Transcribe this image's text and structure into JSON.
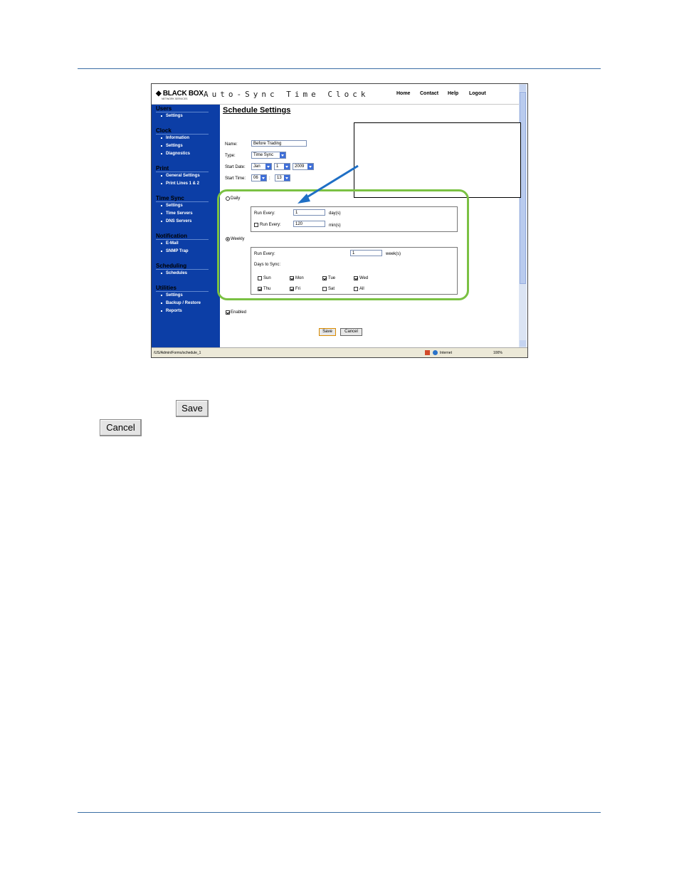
{
  "app": {
    "logo": "BLACK BOX",
    "logo_sub": "NETWORK SERVICES",
    "title": "Auto-Sync Time Clock",
    "nav": {
      "home": "Home",
      "contact": "Contact",
      "help": "Help",
      "logout": "Logout"
    }
  },
  "sidebar": {
    "users": {
      "title": "Users",
      "items": [
        "Settings"
      ]
    },
    "clock": {
      "title": "Clock",
      "items": [
        "Information",
        "Settings",
        "Diagnostics"
      ]
    },
    "print": {
      "title": "Print",
      "items": [
        "General Settings",
        "Print Lines 1 & 2"
      ]
    },
    "timesync": {
      "title": "Time Sync",
      "items": [
        "Settings",
        "Time Servers",
        "DNS Servers"
      ]
    },
    "notification": {
      "title": "Notification",
      "items": [
        "E-Mail",
        "SNMP Trap"
      ]
    },
    "scheduling": {
      "title": "Scheduling",
      "items": [
        "Schedules"
      ]
    },
    "utilities": {
      "title": "Utilities",
      "items": [
        "Settings",
        "Backup / Restore",
        "Reports"
      ]
    }
  },
  "form": {
    "page_title": "Schedule Settings",
    "name_label": "Name:",
    "name_value": "Before Trading",
    "type_label": "Type:",
    "type_value": "Time Sync",
    "start_date_label": "Start Date:",
    "month": "Jan",
    "day": "1",
    "year": "2009",
    "start_time_label": "Start Time:",
    "hour": "06",
    "time_sep": ":",
    "minute": "13",
    "daily_label": "Daily",
    "daily_selected": false,
    "run_every_label": "Run Every:",
    "daily_run_every": "1",
    "days_unit": "day(s)",
    "minutes_checked": false,
    "minutes_run_every": "120",
    "minutes_unit": "min(s)",
    "weekly_label": "Weekly",
    "weekly_selected": true,
    "weekly_run_every": "1",
    "weeks_unit": "week(s)",
    "days_to_sync_label": "Days to Sync:",
    "days": {
      "sun": {
        "label": "Sun",
        "checked": false
      },
      "mon": {
        "label": "Mon",
        "checked": true
      },
      "tue": {
        "label": "Tue",
        "checked": true
      },
      "wed": {
        "label": "Wed",
        "checked": true
      },
      "thu": {
        "label": "Thu",
        "checked": true
      },
      "fri": {
        "label": "Fri",
        "checked": true
      },
      "sat": {
        "label": "Sat",
        "checked": false
      },
      "all": {
        "label": "All",
        "checked": false
      }
    },
    "enabled_label": "Enabled",
    "enabled_checked": true,
    "save_label": "Save",
    "cancel_label": "Cancel"
  },
  "statusbar": {
    "url": "/US/Admin/Forms/schedule_1",
    "zone": "Internet",
    "zoom": "100%"
  },
  "doc": {
    "save_button_label": "Save",
    "cancel_button_label": "Cancel"
  },
  "colors": {
    "sidebar": "#0c3ea6",
    "highlight": "#7ac143",
    "arrow": "#1f6fc5",
    "rule": "#3b6ea5"
  }
}
